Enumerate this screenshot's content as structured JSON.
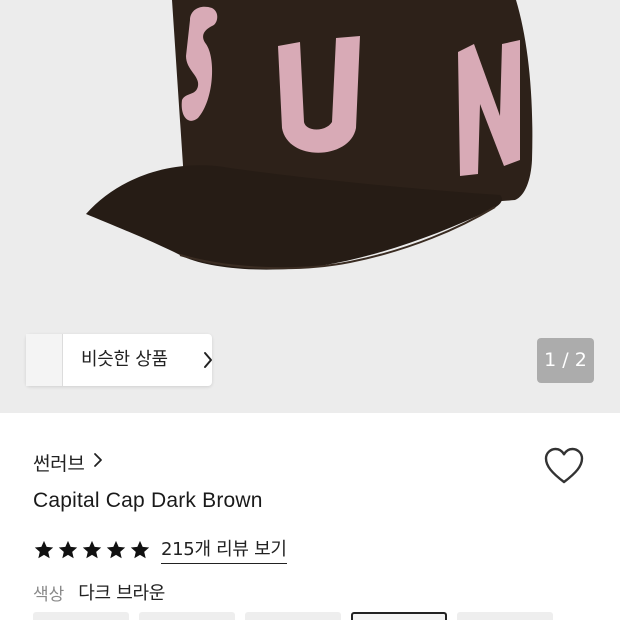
{
  "product_image": {
    "alt": "SUN cap",
    "cap_lettering": "SUN",
    "colors": {
      "cap": "#2d2119",
      "letters": "#d8aab6",
      "background": "#ececec"
    }
  },
  "gallery": {
    "similar_label": "비슷한 상품",
    "counter": "1 / 2"
  },
  "product": {
    "brand": "썬러브",
    "title": "Capital Cap Dark Brown",
    "rating_stars": 5,
    "review_link": "215개 리뷰 보기",
    "color_key": "색상",
    "color_value": "다크 브라운"
  },
  "option_swatches": {
    "count": 5,
    "selected_index": 3
  },
  "icons": {
    "heart": "heart-outline-icon",
    "star": "star-icon",
    "chevron": "chevron-right-icon"
  }
}
